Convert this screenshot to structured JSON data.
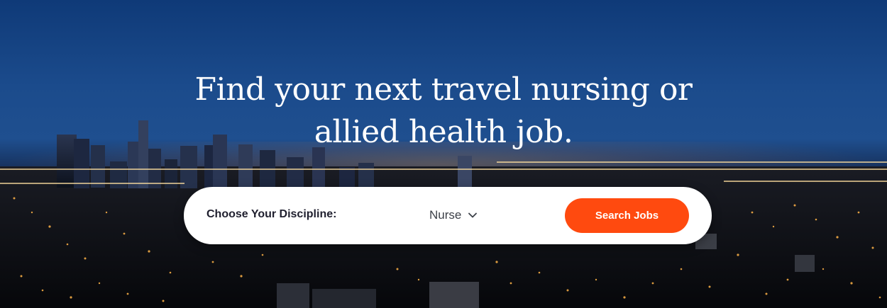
{
  "hero": {
    "headline_line1": "Find your next travel nursing or",
    "headline_line2": "allied health job."
  },
  "search": {
    "discipline_label": "Choose Your Discipline:",
    "discipline_selected": "Nurse",
    "search_button_label": "Search Jobs"
  },
  "colors": {
    "accent": "#ff4a0f",
    "sky_top": "#0f3a78",
    "text_dark": "#1f1f2e"
  },
  "icons": {
    "dropdown": "chevron-down-icon"
  }
}
